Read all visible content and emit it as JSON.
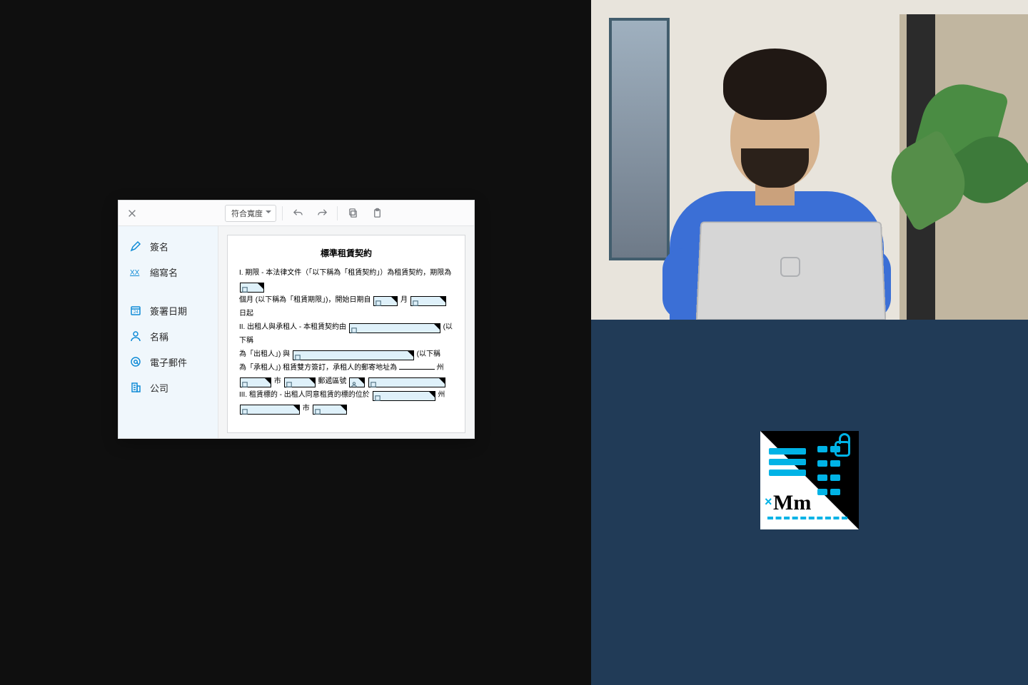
{
  "hero": {
    "alt": "person-at-laptop"
  },
  "editor": {
    "zoom_label": "符合寬度",
    "fields": [
      {
        "icon": "pen-icon",
        "label": "簽名"
      },
      {
        "icon": "initials-icon",
        "label": "縮寫名"
      },
      {
        "icon": "date-icon",
        "label": "簽署日期"
      },
      {
        "icon": "person-icon",
        "label": "名稱"
      },
      {
        "icon": "at-icon",
        "label": "電子郵件"
      },
      {
        "icon": "company-icon",
        "label": "公司"
      }
    ],
    "document": {
      "title": "標準租賃契約",
      "line1_a": "I. 期限 - 本法律文件（「以下稱為「租賃契約」）為租賃契約，期限為",
      "line2_a": "個月 (以下稱為「租賃期限」)，開始日期自",
      "line2_b": "月",
      "line2_c": "日起",
      "line3_a": "II. 出租人與承租人 - 本租賃契約由",
      "line3_b": "(以下稱",
      "line4_a": "為「出租人」) 與",
      "line4_b": "(以下稱",
      "line5_a": "為「承租人」) 租賃雙方簽訂，承租人的郵寄地址為",
      "line5_b": "州",
      "line6_a": "市",
      "line6_b": "郵遞區號",
      "line7_a": "III. 租賃標的 - 出租人同意租賃的標的位於",
      "line7_b": "州",
      "line8_a": "市"
    }
  }
}
